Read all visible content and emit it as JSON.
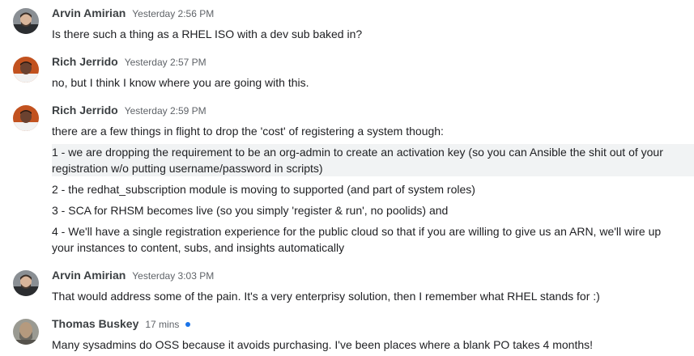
{
  "messages": [
    {
      "author": "Arvin Amirian",
      "time": "Yesterday 2:56 PM",
      "lines": [
        "Is there such a thing as a RHEL ISO with a dev sub baked in?"
      ]
    },
    {
      "author": "Rich Jerrido",
      "time": "Yesterday 2:57 PM",
      "lines": [
        "no, but I think I know where you are going with this."
      ]
    },
    {
      "author": "Rich Jerrido",
      "time": "Yesterday 2:59 PM",
      "lines": [
        "there are a few things in flight to drop the 'cost' of registering a system though:",
        "1 - we are dropping the requirement to be an org-admin to create an activation key (so you can Ansible the shit out of your registration w/o putting username/password in scripts)",
        "2 - the redhat_subscription module is moving to supported (and part of system roles)",
        "3 - SCA for RHSM becomes live (so you simply 'register & run', no poolids) and",
        "4 - We'll have a single registration experience for the public cloud so that if you are willing to give us an ARN, we'll wire up your instances to content, subs, and insights automatically"
      ]
    },
    {
      "author": "Arvin Amirian",
      "time": "Yesterday 3:03 PM",
      "lines": [
        "That would address some of the pain. It's a very enterprisy solution, then I remember what RHEL stands for :)"
      ]
    },
    {
      "author": "Thomas Buskey",
      "time": "17 mins",
      "lines": [
        "Many sysadmins do OSS because it avoids purchasing.  I've been places where a blank PO takes 4 months!"
      ]
    }
  ],
  "colors": {
    "online_indicator": "#1a73e8",
    "hover_row": "#f1f3f4"
  }
}
